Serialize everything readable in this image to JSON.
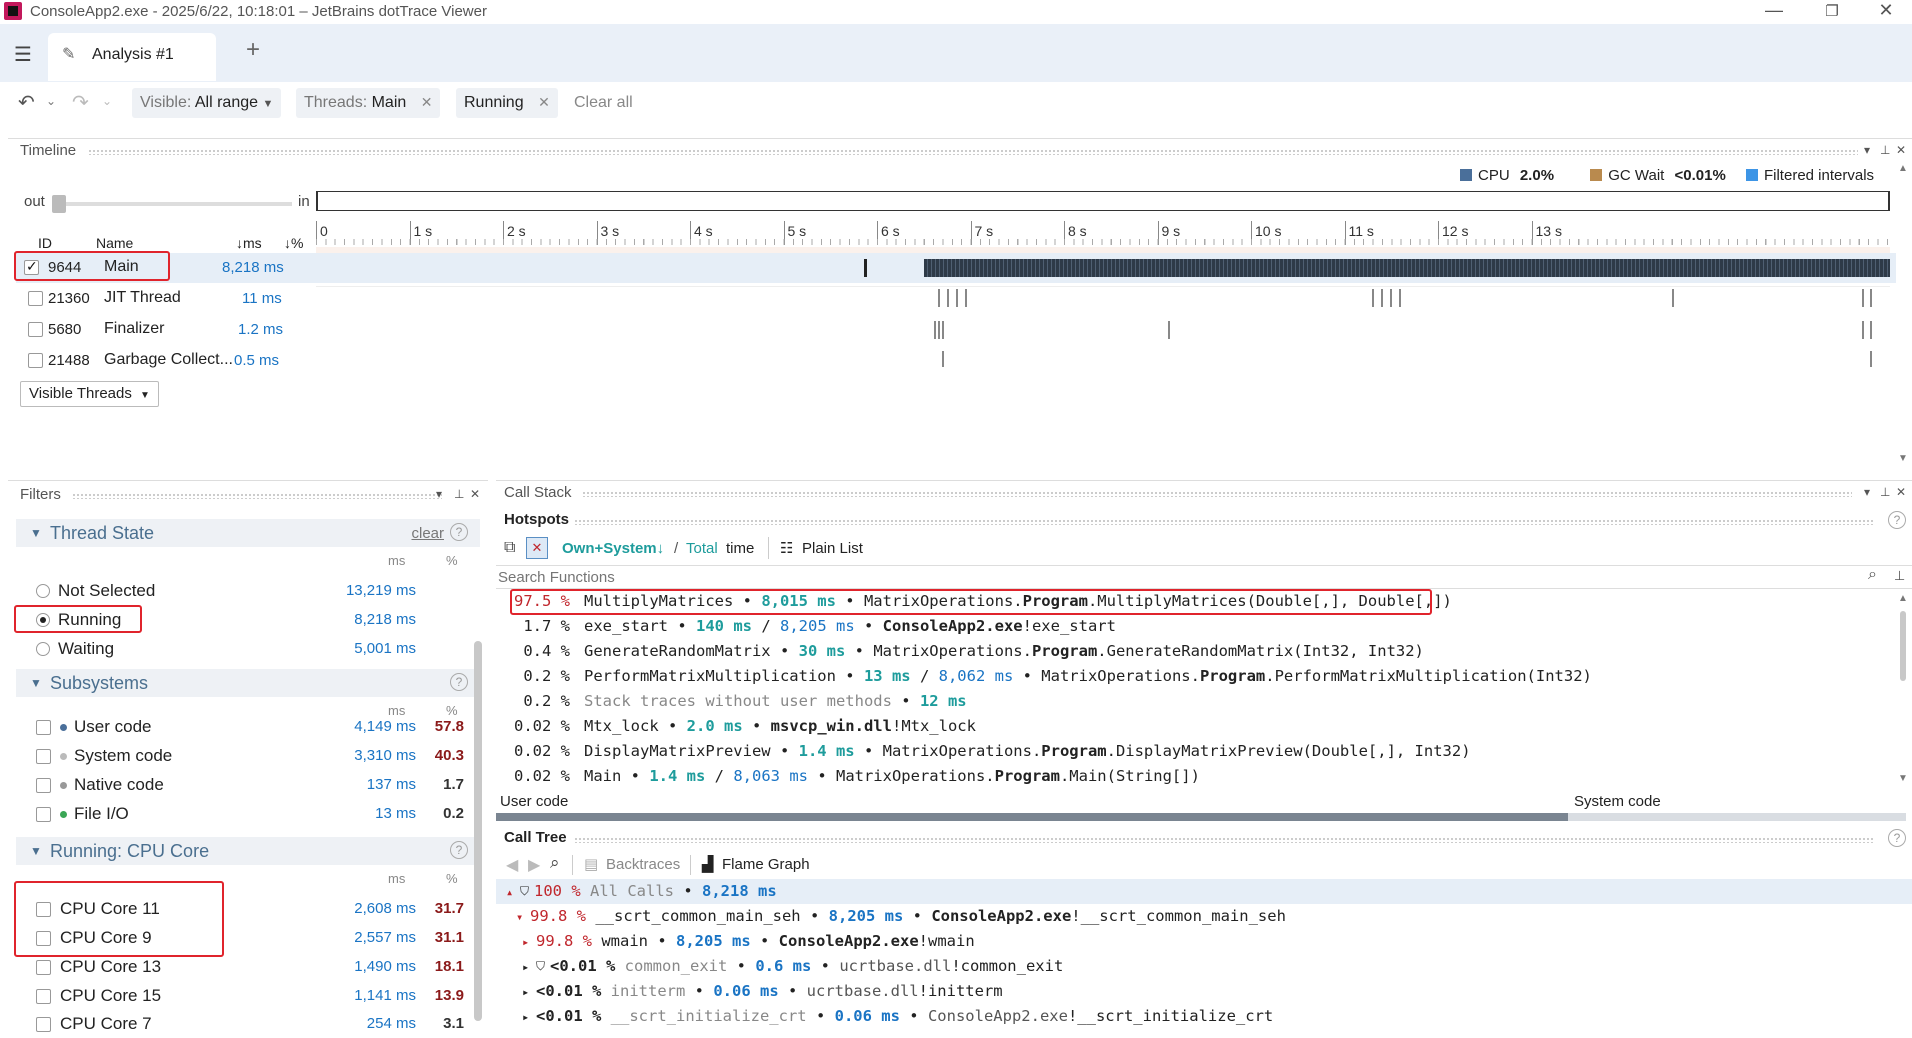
{
  "window": {
    "title": "ConsoleApp2.exe - 2025/6/22, 10:18:01 – JetBrains dotTrace Viewer"
  },
  "tabs": [
    {
      "label": "Analysis #1"
    }
  ],
  "toolbar": {
    "visible_label": "Visible:",
    "visible_value": "All range",
    "threads_label": "Threads:",
    "threads_value": "Main",
    "running_chip": "Running",
    "clear_all": "Clear all"
  },
  "timeline": {
    "title": "Timeline",
    "legend": [
      {
        "name": "CPU",
        "value": "2.0%",
        "color": "#4a6f9a"
      },
      {
        "name": "GC Wait",
        "value": "<0.01%",
        "color": "#b98a4e"
      },
      {
        "name": "Filtered intervals",
        "value": "",
        "color": "#3d95e6"
      }
    ],
    "zoom_out": "out",
    "zoom_in": "in",
    "ticks": [
      "0",
      "1 s",
      "2 s",
      "3 s",
      "4 s",
      "5 s",
      "6 s",
      "7 s",
      "8 s",
      "9 s",
      "10 s",
      "11 s",
      "12 s",
      "13 s"
    ],
    "columns": {
      "id": "ID",
      "name": "Name",
      "ms": "↓ms",
      "pct": "↓%"
    },
    "threads": [
      {
        "id": "9644",
        "name": "Main",
        "ms": "8,218 ms",
        "checked": true
      },
      {
        "id": "21360",
        "name": "JIT Thread",
        "ms": "11 ms",
        "checked": false
      },
      {
        "id": "5680",
        "name": "Finalizer",
        "ms": "1.2 ms",
        "checked": false
      },
      {
        "id": "21488",
        "name": "Garbage Collect...",
        "ms": "0.5 ms",
        "checked": false
      }
    ],
    "visible_threads_button": "Visible Threads"
  },
  "filters": {
    "title": "Filters",
    "thread_state": {
      "title": "Thread State",
      "clear": "clear",
      "col_ms": "ms",
      "col_pct": "%",
      "items": [
        {
          "label": "Not Selected",
          "ms": "13,219 ms",
          "selected": false
        },
        {
          "label": "Running",
          "ms": "8,218 ms",
          "selected": true
        },
        {
          "label": "Waiting",
          "ms": "5,001 ms",
          "selected": false
        }
      ]
    },
    "subsystems": {
      "title": "Subsystems",
      "col_ms": "ms",
      "col_pct": "%",
      "items": [
        {
          "label": "User code",
          "ms": "4,149 ms",
          "pct": "57.8",
          "dot": "#4a6f9a",
          "pct_color": "#8b1a1a"
        },
        {
          "label": "System code",
          "ms": "3,310 ms",
          "pct": "40.3",
          "dot": "#bbbbbb",
          "pct_color": "#8b1a1a"
        },
        {
          "label": "Native code",
          "ms": "137 ms",
          "pct": "1.7",
          "dot": "#999999",
          "pct_color": "#333333"
        },
        {
          "label": "File I/O",
          "ms": "13 ms",
          "pct": "0.2",
          "dot": "#3aa655",
          "pct_color": "#333333"
        }
      ]
    },
    "cpu_core": {
      "title": "Running: CPU Core",
      "col_ms": "ms",
      "col_pct": "%",
      "items": [
        {
          "label": "CPU Core 11",
          "ms": "2,608 ms",
          "pct": "31.7",
          "pct_color": "#8b1a1a"
        },
        {
          "label": "CPU Core 9",
          "ms": "2,557 ms",
          "pct": "31.1",
          "pct_color": "#8b1a1a"
        },
        {
          "label": "CPU Core 13",
          "ms": "1,490 ms",
          "pct": "18.1",
          "pct_color": "#8b1a1a"
        },
        {
          "label": "CPU Core 15",
          "ms": "1,141 ms",
          "pct": "13.9",
          "pct_color": "#8b1a1a"
        },
        {
          "label": "CPU Core 7",
          "ms": "254 ms",
          "pct": "3.1",
          "pct_color": "#333333"
        }
      ]
    }
  },
  "callstack": {
    "title": "Call Stack",
    "hotspots": {
      "title": "Hotspots",
      "own_system": "Own+System↓",
      "sep": "/",
      "total": "Total",
      "time": "time",
      "plain_list": "Plain List",
      "search_placeholder": "Search Functions",
      "rows": [
        {
          "pct": "97.5 %",
          "name": "MultiplyMatrices",
          "own": "8,015 ms",
          "total": "",
          "ns": "MatrixOperations.",
          "cls": "Program",
          "sig": ".MultiplyMatrices(Double[,], Double[,])"
        },
        {
          "pct": "1.7 %",
          "name": "exe_start",
          "own": "140 ms",
          "total": "8,205 ms",
          "ns": "",
          "cls": "ConsoleApp2.exe",
          "sig": "!exe_start"
        },
        {
          "pct": "0.4 %",
          "name": "GenerateRandomMatrix",
          "own": "30 ms",
          "total": "",
          "ns": "MatrixOperations.",
          "cls": "Program",
          "sig": ".GenerateRandomMatrix(Int32, Int32)"
        },
        {
          "pct": "0.2 %",
          "name": "PerformMatrixMultiplication",
          "own": "13 ms",
          "total": "8,062 ms",
          "ns": "MatrixOperations.",
          "cls": "Program",
          "sig": ".PerformMatrixMultiplication(Int32)"
        },
        {
          "pct": "0.2 %",
          "name": "Stack traces without user methods",
          "own": "12 ms",
          "total": "",
          "ns": "",
          "cls": "",
          "sig": ""
        },
        {
          "pct": "0.02 %",
          "name": "Mtx_lock",
          "own": "2.0 ms",
          "total": "",
          "ns": "",
          "cls": "msvcp_win.dll",
          "sig": "!Mtx_lock"
        },
        {
          "pct": "0.02 %",
          "name": "DisplayMatrixPreview",
          "own": "1.4 ms",
          "total": "",
          "ns": "MatrixOperations.",
          "cls": "Program",
          "sig": ".DisplayMatrixPreview(Double[,], Int32)"
        },
        {
          "pct": "0.02 %",
          "name": "Main",
          "own": "1.4 ms",
          "total": "8,063 ms",
          "ns": "MatrixOperations.",
          "cls": "Program",
          "sig": ".Main(String[])"
        }
      ],
      "bar_user": "User code",
      "bar_system": "System code"
    },
    "calltree": {
      "title": "Call Tree",
      "backtraces": "Backtraces",
      "flame_graph": "Flame Graph",
      "rows": [
        {
          "pct": "100 %",
          "name": "All Calls",
          "ms": "8,218 ms",
          "cls": "",
          "sig": ""
        },
        {
          "pct": "99.8 %",
          "name": "__scrt_common_main_seh",
          "ms": "8,205 ms",
          "cls": "ConsoleApp2.exe",
          "sig": "!__scrt_common_main_seh"
        },
        {
          "pct": "99.8 %",
          "name": "wmain",
          "ms": "8,205 ms",
          "cls": "ConsoleApp2.exe",
          "sig": "!wmain"
        },
        {
          "pct": "<0.01 %",
          "name": "common_exit",
          "ms": "0.6 ms",
          "cls": "ucrtbase.dll",
          "sig": "!common_exit"
        },
        {
          "pct": "<0.01 %",
          "name": "initterm",
          "ms": "0.06 ms",
          "cls": "ucrtbase.dll",
          "sig": "!initterm"
        },
        {
          "pct": "<0.01 %",
          "name": "__scrt_initialize_crt",
          "ms": "0.06 ms",
          "cls": "ConsoleApp2.exe",
          "sig": "!__scrt_initialize_crt"
        }
      ]
    }
  }
}
